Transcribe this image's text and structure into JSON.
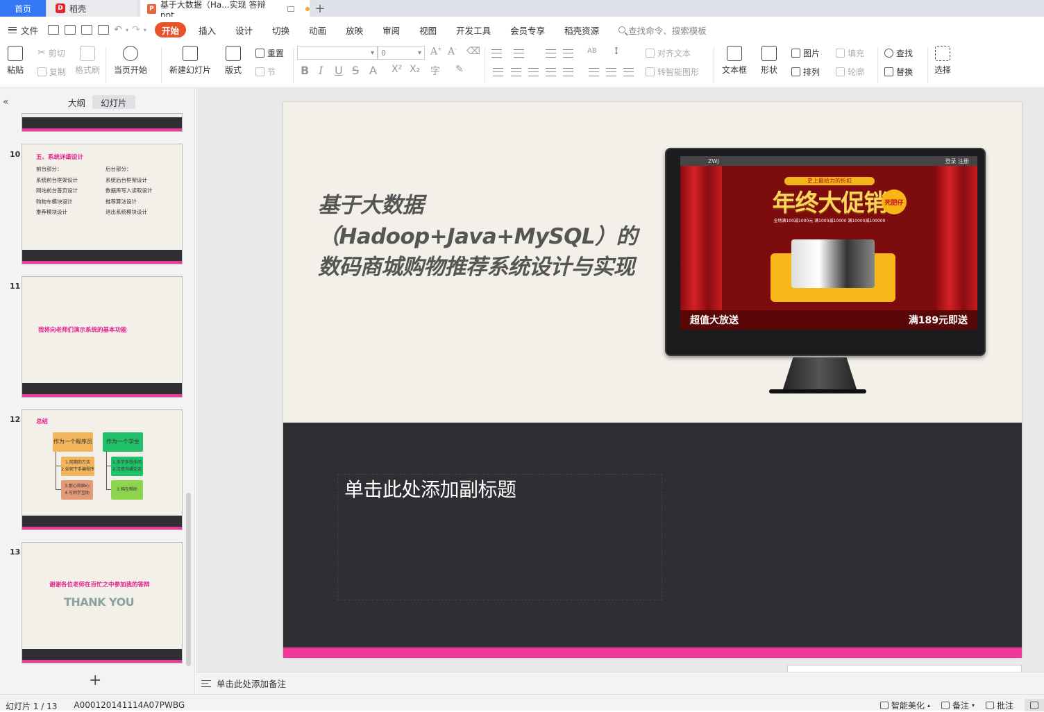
{
  "tabs": {
    "home": "首页",
    "daoke": "稻壳",
    "doc": "基于大数据（Ha...实现 答辩ppt",
    "new": "+"
  },
  "menu": {
    "file": "文件",
    "items": [
      "开始",
      "插入",
      "设计",
      "切换",
      "动画",
      "放映",
      "审阅",
      "视图",
      "开发工具",
      "会员专享",
      "稻壳资源"
    ],
    "search": "查找命令、搜索模板"
  },
  "ribbon": {
    "paste": "粘贴",
    "cut": "剪切",
    "copy": "复制",
    "format_painter": "格式刷",
    "from_current": "当页开始",
    "new_slide": "新建幻灯片",
    "layout": "版式",
    "reset": "重置",
    "section": "节",
    "font_size": "0",
    "align_text": "对齐文本",
    "smart_shape": "转智能图形",
    "textbox": "文本框",
    "shape": "形状",
    "picture": "图片",
    "arrange": "排列",
    "fill": "填充",
    "outline": "轮廓",
    "find": "查找",
    "replace": "替换",
    "select": "选择"
  },
  "left_panel": {
    "outline_tab": "大纲",
    "slides_tab": "幻灯片",
    "collapse": "«",
    "add": "+"
  },
  "thumbs": {
    "n10": "10",
    "t10_title": "五、系统详细设计",
    "t10_col1": [
      "前台部分：",
      "系统前台框架设计",
      "网站前台首页设计",
      "购物车模块设计",
      "推荐模块设计"
    ],
    "t10_col2": [
      "后台部分：",
      "系统后台框架设计",
      "数据库写入读取设计",
      "推荐算法设计",
      "退出系统模块设计"
    ],
    "n11": "11",
    "t11_text": "我将向老师们演示系统的基本功能",
    "n12": "12",
    "t12_title": "总结",
    "t12_left_head": "作为一个程序员",
    "t12_right_head": "作为一个学生",
    "t12_l1": "1.前期的方法\n2.如何下手编程序",
    "t12_l2": "3.耐心和细心\n4.与同学互助",
    "t12_r1": "1.多学多想多问\n2.注意沟通交流",
    "t12_r2": "3.相互帮助",
    "n13": "13",
    "t13_text": "谢谢各位老师在百忙之中参加我的答辩",
    "t13_thanks": "THANK YOU"
  },
  "slide": {
    "title": "基于大数据（Hadoop+Java+MySQL）的数码商城购物推荐系统设计与实现",
    "subtitle": "单击此处添加副标题",
    "screen_brand": "ZWJ",
    "screen_login": "登录 注册",
    "promo_top": "史上最给力的折扣",
    "promo": "年终大促销",
    "promo_sub": "全场满100减1000元 满1000减10000 满10000减100000",
    "badge": "死肥仔",
    "strip_left": "超值大放送",
    "strip_right": "满189元即送"
  },
  "notes": "单击此处添加备注",
  "status": {
    "slide_pos": "幻灯片 1 / 13",
    "template": "A000120141114A07PWBG",
    "beautify": "智能美化",
    "notes": "备注",
    "comment": "批注"
  }
}
